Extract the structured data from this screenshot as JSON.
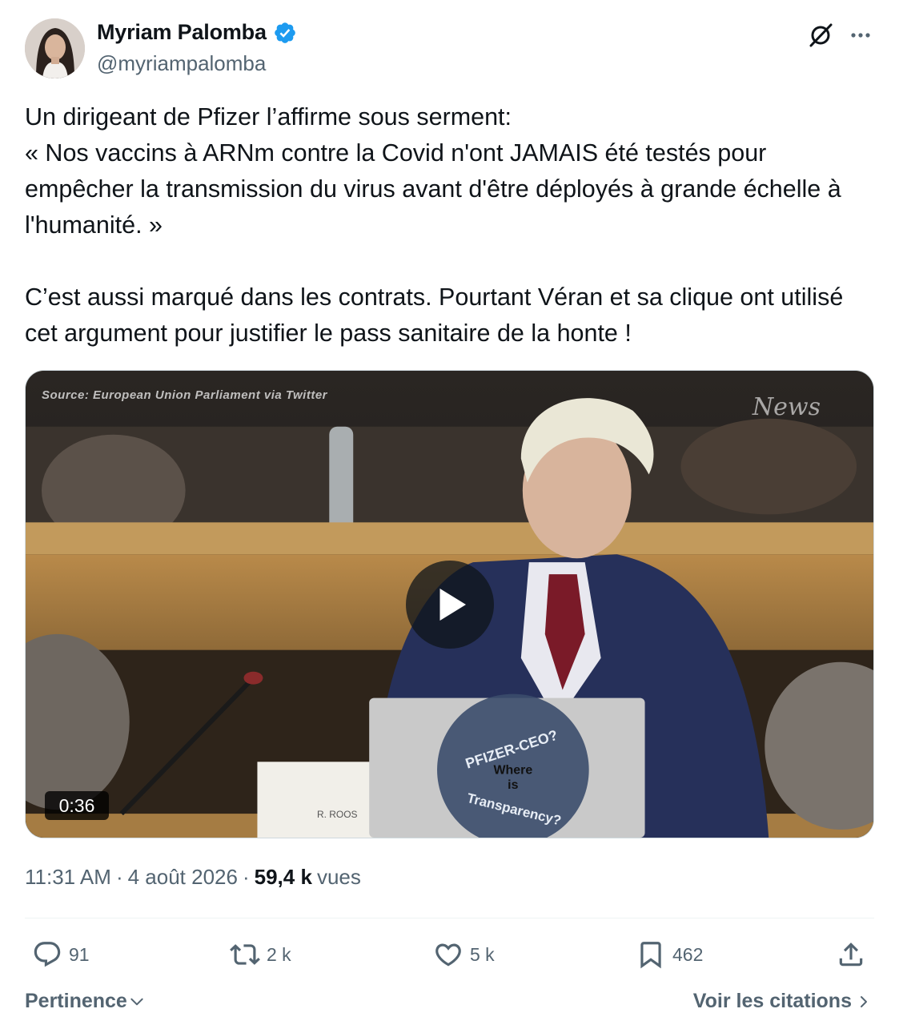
{
  "author": {
    "display_name": "Myriam Palomba",
    "handle": "@myriampalomba",
    "verified": true,
    "verified_color": "#1d9bf0"
  },
  "icons": {
    "grok": "grok-icon",
    "more": "more-dots-icon"
  },
  "tweet": {
    "lines": [
      "Un dirigeant de Pfizer l’affirme sous serment:",
      "« Nos vaccins à ARNm contre la Covid n'ont JAMAIS été testés pour empêcher la transmission du virus avant d'être déployés à grande échelle à l'humanité. »",
      "C’est aussi marqué dans les contrats. Pourtant Véran et sa clique ont utilisé cet argument pour justifier le pass sanitaire de la honte !"
    ]
  },
  "media": {
    "type": "video",
    "source_caption": "Source: European Union Parliament via Twitter",
    "logo_text": "News",
    "nameplate": "R. ROOS",
    "laptop_sticker": [
      "PFIZER-CEO?",
      "Where",
      "is",
      "Transparency?"
    ],
    "duration": "0:36"
  },
  "meta": {
    "time": "11:31 AM",
    "separator": "·",
    "date": "4 août 2026",
    "views_count": "59,4 k",
    "views_label": "vues"
  },
  "actions": {
    "replies": "91",
    "reposts": "2 k",
    "likes": "5 k",
    "bookmarks": "462"
  },
  "footer": {
    "sort_label": "Pertinence",
    "quotes_label": "Voir les citations"
  },
  "colors": {
    "text_primary": "#0f1419",
    "text_secondary": "#536471",
    "divider": "#eff3f4"
  }
}
